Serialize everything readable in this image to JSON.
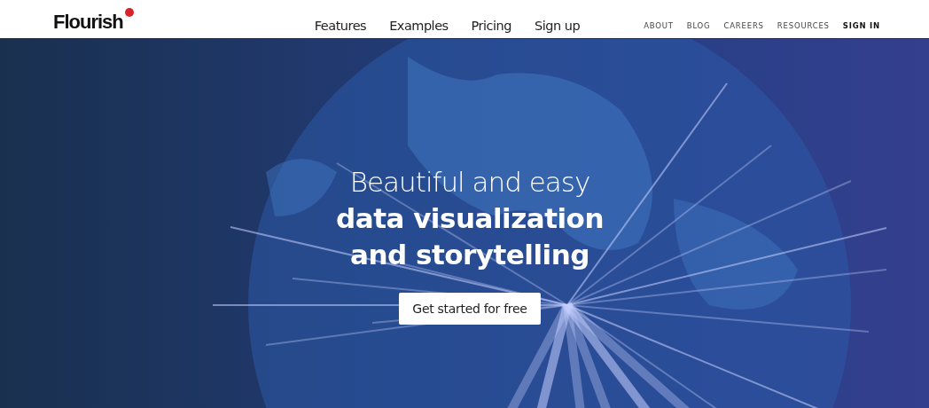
{
  "header": {
    "logo": "Flourish",
    "main_nav": [
      {
        "label": "Features"
      },
      {
        "label": "Examples"
      },
      {
        "label": "Pricing"
      },
      {
        "label": "Sign up"
      }
    ],
    "secondary_nav": [
      {
        "label": "ABOUT",
        "bold": false
      },
      {
        "label": "BLOG",
        "bold": false
      },
      {
        "label": "CAREERS",
        "bold": false
      },
      {
        "label": "RESOURCES",
        "bold": false
      },
      {
        "label": "SIGN IN",
        "bold": true
      }
    ]
  },
  "hero": {
    "headline": [
      {
        "text": "Beautiful and easy",
        "kind": "light"
      },
      {
        "text": "data visualization",
        "kind": "bold"
      },
      {
        "text": "and storytelling",
        "kind": "bold"
      }
    ],
    "button": "Get started for free"
  }
}
